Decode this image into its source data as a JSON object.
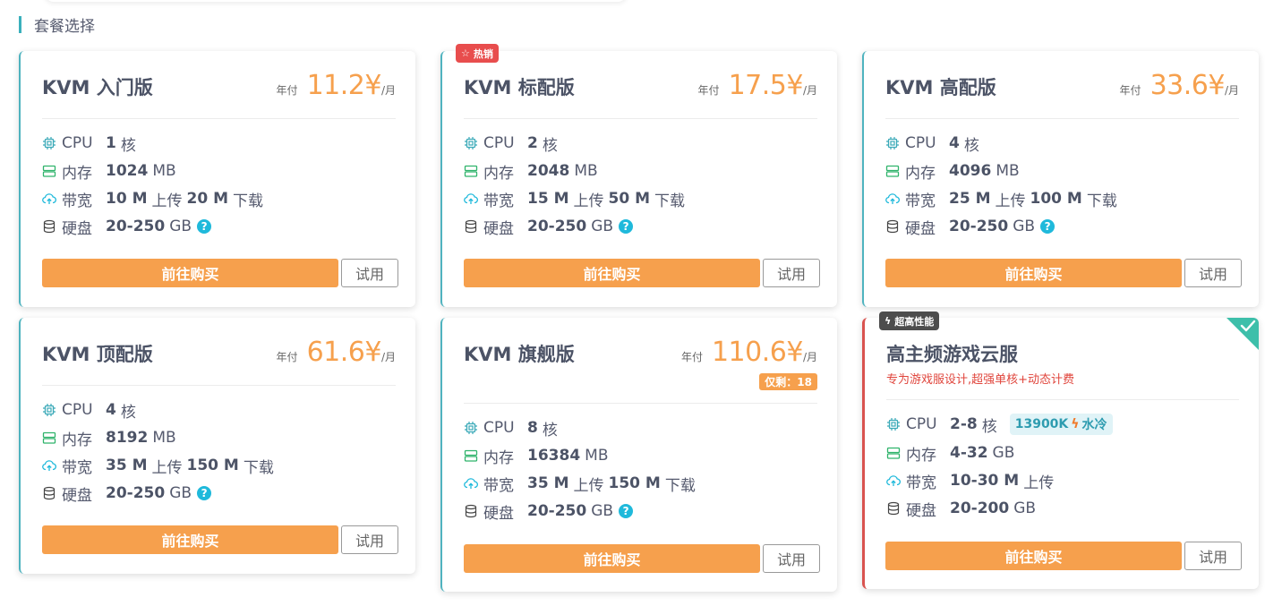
{
  "section_title": "套餐选择",
  "labels": {
    "cpu": "CPU",
    "mem": "内存",
    "bw": "带宽",
    "disk": "硬盘",
    "core": "核",
    "mb": "MB",
    "gb": "GB",
    "upload": "上传",
    "download": "下载",
    "help": "?",
    "period": "年付",
    "unit": "/月",
    "buy": "前往购买",
    "try": "试用"
  },
  "colors": {
    "accent": "#f6a04d",
    "teal": "#4fb3bf",
    "red": "#e84d4d",
    "help": "#1fb9db"
  },
  "plans": [
    {
      "name": "KVM 入门版",
      "price": "11.2¥",
      "cpu": "1",
      "mem": "1024",
      "up": "10 M",
      "down": "20 M",
      "disk": "20-250"
    },
    {
      "name": "KVM 标配版",
      "ribbon": "热销",
      "price": "17.5¥",
      "cpu": "2",
      "mem": "2048",
      "up": "15 M",
      "down": "50 M",
      "disk": "20-250"
    },
    {
      "name": "KVM 高配版",
      "price": "33.6¥",
      "cpu": "4",
      "mem": "4096",
      "up": "25 M",
      "down": "100 M",
      "disk": "20-250"
    },
    {
      "name": "KVM 顶配版",
      "price": "61.6¥",
      "cpu": "4",
      "mem": "8192",
      "up": "35 M",
      "down": "150 M",
      "disk": "20-250"
    },
    {
      "name": "KVM 旗舰版",
      "price": "110.6¥",
      "stock": "仅剩：18",
      "cpu": "8",
      "mem": "16384",
      "up": "35 M",
      "down": "150 M",
      "disk": "20-250"
    },
    {
      "name": "高主频游戏云服",
      "ribbon": "超高性能",
      "subtitle": "专为游戏服设计,超强单核+动态计费",
      "cpu": "2-8",
      "cpu_badge_model": "13900K",
      "cpu_badge_cooling": "水冷",
      "mem": "4-32",
      "up": "10-30 M",
      "disk": "20-200"
    }
  ]
}
